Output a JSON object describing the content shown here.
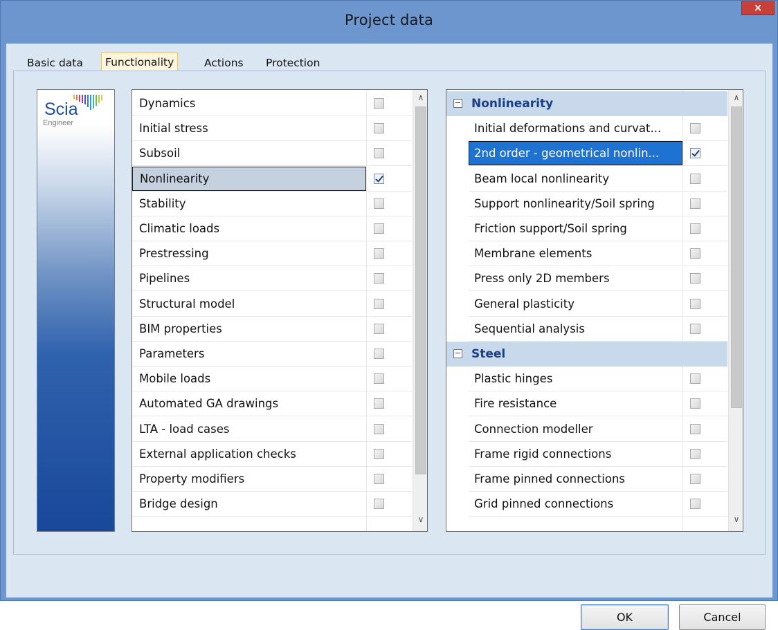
{
  "window": {
    "title": "Project data",
    "close_glyph": "×"
  },
  "tabs": [
    "Basic data",
    "Functionality",
    "Actions",
    "Protection"
  ],
  "logo": {
    "brand": "Scia",
    "sub": "Engineer"
  },
  "left_list": [
    {
      "label": "Dynamics",
      "checked": false
    },
    {
      "label": "Initial stress",
      "checked": false
    },
    {
      "label": "Subsoil",
      "checked": false
    },
    {
      "label": "Nonlinearity",
      "checked": true
    },
    {
      "label": "Stability",
      "checked": false
    },
    {
      "label": "Climatic loads",
      "checked": false
    },
    {
      "label": "Prestressing",
      "checked": false
    },
    {
      "label": "Pipelines",
      "checked": false
    },
    {
      "label": "Structural model",
      "checked": false
    },
    {
      "label": "BIM properties",
      "checked": false
    },
    {
      "label": "Parameters",
      "checked": false
    },
    {
      "label": "Mobile loads",
      "checked": false
    },
    {
      "label": "Automated GA drawings",
      "checked": false
    },
    {
      "label": "LTA - load cases",
      "checked": false
    },
    {
      "label": "External application checks",
      "checked": false
    },
    {
      "label": "Property modifiers",
      "checked": false
    },
    {
      "label": "Bridge design",
      "checked": false
    }
  ],
  "right_groups": [
    {
      "title": "Nonlinearity",
      "collapse_glyph": "−",
      "items": [
        {
          "label": "Initial deformations and curvat...",
          "checked": false
        },
        {
          "label": "2nd order - geometrical nonlin...",
          "checked": true
        },
        {
          "label": "Beam local nonlinearity",
          "checked": false
        },
        {
          "label": "Support nonlinearity/Soil spring",
          "checked": false
        },
        {
          "label": "Friction support/Soil spring",
          "checked": false
        },
        {
          "label": "Membrane elements",
          "checked": false
        },
        {
          "label": "Press only 2D members",
          "checked": false
        },
        {
          "label": "General plasticity",
          "checked": false
        },
        {
          "label": "Sequential analysis",
          "checked": false
        }
      ]
    },
    {
      "title": "Steel",
      "collapse_glyph": "−",
      "items": [
        {
          "label": "Plastic hinges",
          "checked": false
        },
        {
          "label": "Fire resistance",
          "checked": false
        },
        {
          "label": "Connection modeller",
          "checked": false
        },
        {
          "label": "Frame rigid connections",
          "checked": false
        },
        {
          "label": "Frame pinned connections",
          "checked": false
        },
        {
          "label": "Grid pinned connections",
          "checked": false
        }
      ]
    }
  ],
  "scroll_glyphs": {
    "up": "∧",
    "down": "∨"
  },
  "buttons": {
    "ok": "OK",
    "cancel": "Cancel"
  },
  "colors": {
    "titlebar": "#6d96cf",
    "close": "#c8403a",
    "selection": "#1e73d2",
    "group_bg": "#c9d9ec"
  }
}
